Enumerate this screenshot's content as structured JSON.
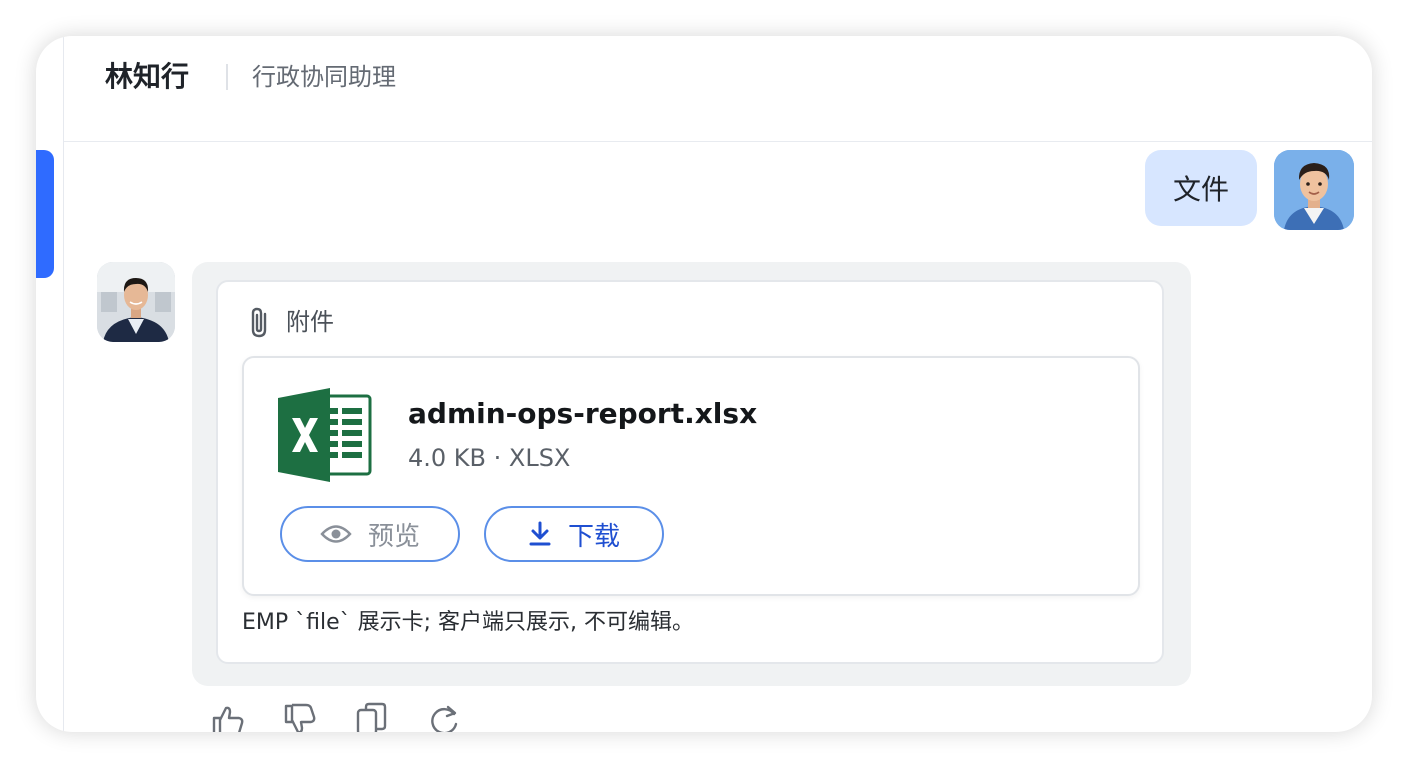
{
  "header": {
    "name": "林知行",
    "role": "行政协同助理"
  },
  "user_message": {
    "text": "文件"
  },
  "bot_message": {
    "attachment_label": "附件",
    "file": {
      "name": "admin-ops-report.xlsx",
      "meta": "4.0 KB · XLSX",
      "icon": "excel-file-icon"
    },
    "buttons": {
      "preview_label": "预览",
      "download_label": "下载"
    },
    "caption": "EMP `file` 展示卡; 客户端只展示, 不可编辑。"
  },
  "actions": [
    "thumbs-up-icon",
    "thumbs-down-icon",
    "copy-icon",
    "refresh-icon"
  ],
  "colors": {
    "accent": "#2f6bff",
    "user_bubble": "#d7e6ff",
    "button_border": "#5b8fe8",
    "download_text": "#1f4fd1",
    "excel_green": "#1d6f42"
  }
}
